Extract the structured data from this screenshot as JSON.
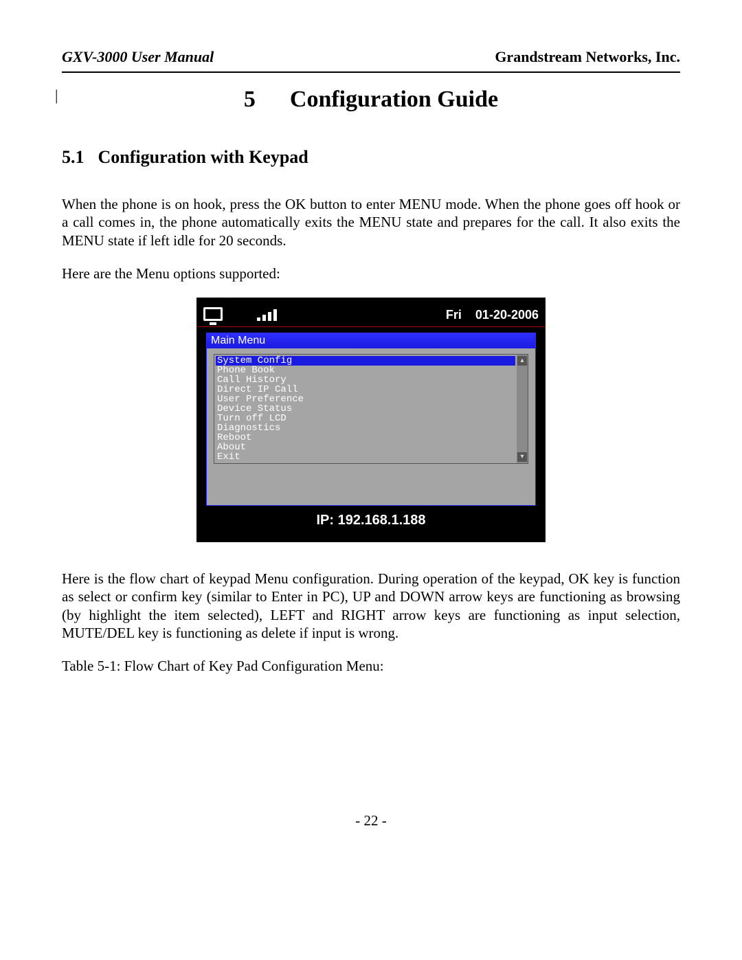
{
  "header": {
    "left": "GXV-3000 User Manual",
    "right": "Grandstream Networks, Inc."
  },
  "chapter": {
    "number": "5",
    "title": "Configuration Guide"
  },
  "section": {
    "number": "5.1",
    "title": "Configuration with Keypad"
  },
  "para1": "When the phone is on hook, press the OK button to enter MENU mode. When the phone goes off hook or a call comes in, the phone automatically exits the MENU state and prepares for the call. It also exits the MENU state if left idle for 20 seconds.",
  "para2": "Here are the Menu options supported:",
  "phone": {
    "day": "Fri",
    "date": "01-20-2006",
    "menu_title": "Main Menu",
    "items": [
      "System Config",
      "Phone Book",
      "Call History",
      "Direct IP Call",
      "User Preference",
      "Device Status",
      "Turn off LCD",
      "Diagnostics",
      "Reboot",
      "About",
      "Exit"
    ],
    "selected_index": 0,
    "ip_label": "IP: 192.168.1.188"
  },
  "para3": "Here is the flow chart of keypad Menu configuration. During operation of the keypad, OK key is function as select or confirm key (similar to Enter in PC), UP and DOWN arrow keys are functioning as browsing (by highlight the item selected), LEFT and RIGHT arrow keys are functioning as input selection, MUTE/DEL key is functioning as delete if input is wrong.",
  "table_caption": "Table 5-1: Flow Chart of Key Pad Configuration Menu:",
  "page_number": "- 22 -"
}
